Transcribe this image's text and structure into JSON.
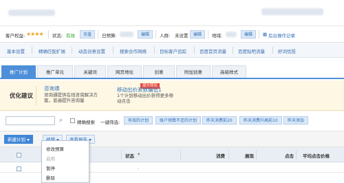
{
  "account": {
    "balance_label": "客户权益:",
    "status_label": "状态:",
    "status_value": "有效",
    "recharge": "充值",
    "budget_label": "日预算:",
    "budget_edit": "编辑",
    "people_label": "人群:",
    "people_value": "未设置",
    "people_edit": "编辑",
    "region_label": "地域:",
    "region_edit": "编辑",
    "log": "后台操作记录"
  },
  "tools": [
    "基本设置",
    "精确匹配扩展",
    "动态创意设置",
    "搜索合作网络",
    "目标客户追踪",
    "百度首页流量",
    "百度贴吧流量",
    "好词优投"
  ],
  "tabs": [
    "推广计划",
    "推广单元",
    "关键词",
    "网页地址",
    "创意",
    "附加创意",
    "高级样式"
  ],
  "suggestion": {
    "title": "优化建议",
    "item1_link": "咨询通",
    "item1_desc1": "咨询通提供在线咨询解决方",
    "item1_desc2": "案，普遍提升咨询量",
    "badge": "提升转化",
    "item2_link": "移动出价系数偏低1",
    "item2_desc1": "1个计划移动出价获得更多移",
    "item2_desc2": "动点击"
  },
  "filter": {
    "exact_search": "精确搜索",
    "quick_filter": "一键筛选:",
    "chips": [
      "有效的计划",
      "账户预算不足的计划",
      "昨天消费前20",
      "昨天消费升高前10",
      "昨天添加"
    ]
  },
  "actions": {
    "new_plan": "新建计划",
    "edit": "编辑",
    "view_report": "查看报告"
  },
  "table": {
    "headers": [
      "状态",
      "消费",
      "展现",
      "点击",
      "平均点击价格"
    ]
  },
  "dropdown": {
    "items": [
      {
        "label": "修改预算",
        "disabled": false
      },
      {
        "label": "启用",
        "disabled": true
      },
      {
        "label": "暂停",
        "disabled": false
      },
      {
        "label": "删除",
        "disabled": false
      }
    ]
  }
}
